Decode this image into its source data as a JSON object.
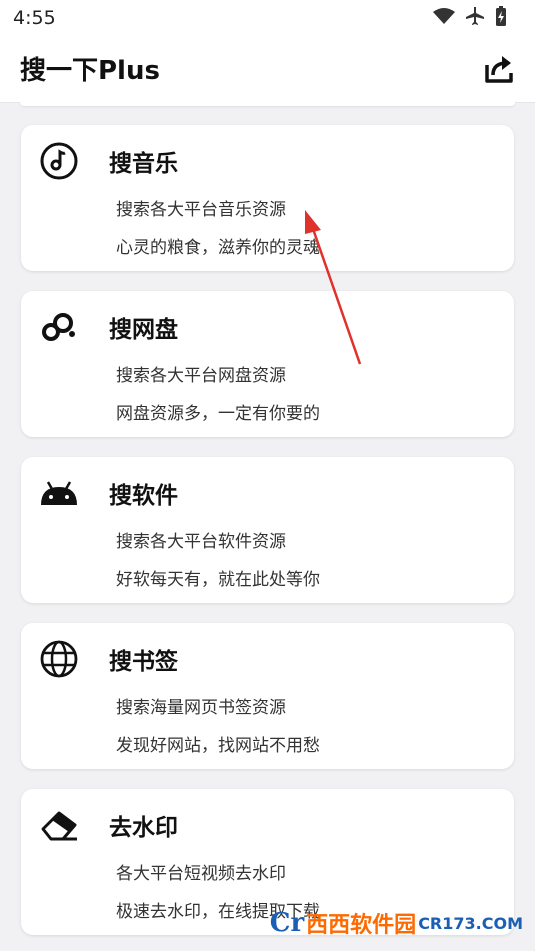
{
  "status_bar": {
    "time": "4:55"
  },
  "app_bar": {
    "title": "搜一下Plus",
    "share_icon": "share-icon"
  },
  "cards": [
    {
      "icon": "music-note-icon",
      "title": "搜音乐",
      "line1": "搜索各大平台音乐资源",
      "line2": "心灵的粮食，滋养你的灵魂"
    },
    {
      "icon": "cloud-disk-icon",
      "title": "搜网盘",
      "line1": "搜索各大平台网盘资源",
      "line2": "网盘资源多，一定有你要的"
    },
    {
      "icon": "android-icon",
      "title": "搜软件",
      "line1": "搜索各大平台软件资源",
      "line2": "好软每天有，就在此处等你"
    },
    {
      "icon": "globe-icon",
      "title": "搜书签",
      "line1": "搜索海量网页书签资源",
      "line2": "发现好网站，找网站不用愁"
    },
    {
      "icon": "eraser-icon",
      "title": "去水印",
      "line1": "各大平台短视频去水印",
      "line2": "极速去水印，在线提取下载"
    }
  ],
  "watermark": {
    "main": "西西软件园",
    "sub": "CR173.COM"
  },
  "colors": {
    "accent_arrow": "#e0312b",
    "background": "#f1f1f4",
    "card": "#ffffff"
  }
}
